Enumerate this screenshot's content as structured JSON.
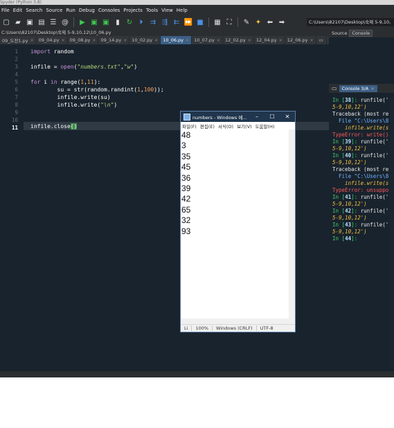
{
  "title_strip": "Spyder (Python 3.8)",
  "menubar": [
    "File",
    "Edit",
    "Search",
    "Source",
    "Run",
    "Debug",
    "Consoles",
    "Projects",
    "Tools",
    "View",
    "Help"
  ],
  "toolbar": {
    "path": "C:\\Users\\82107\\Desktop\\숙제 5-9,10,"
  },
  "editor": {
    "filepath": "C:\\Users\\82107\\Desktop\\숙제 5-9,10,12\\10_06.py",
    "tabs": [
      "09_도전1.py",
      "09_04.py",
      "09_08.py",
      "09_14.py",
      "10_02.py",
      "10_06.py",
      "10_07.py",
      "12_02.py",
      "12_04.py",
      "12_06.py"
    ],
    "active_tab": "10_06.py",
    "line_numbers": [
      "1",
      "2",
      "3",
      "4",
      "5",
      "6",
      "7",
      "8",
      "9",
      "10",
      "11"
    ],
    "current_line": "11",
    "code": {
      "l1_kw": "import",
      "l1_rest": " random",
      "l3_a": "infile = ",
      "l3_fn": "open",
      "l3_b": "(",
      "l3_s1": "\"numbers.txt\"",
      "l3_c": ",",
      "l3_s2": "\"w\"",
      "l3_d": ")",
      "l5_kw1": "for",
      "l5_a": " i ",
      "l5_kw2": "in",
      "l5_b": " range(",
      "l5_n1": "1",
      "l5_c": ",",
      "l5_n2": "11",
      "l5_d": "):",
      "l6_a": "        su = str(random.randint(",
      "l6_n1": "1",
      "l6_b": ",",
      "l6_n2": "100",
      "l6_c": "));",
      "l7": "        infile.write(su)",
      "l8_a": "        infile.write(",
      "l8_s": "\"\\n\"",
      "l8_b": ")",
      "l11_a": "infile.close",
      "l11_b": "()"
    }
  },
  "right_pane": {
    "tabs": [
      "Source",
      "Console"
    ],
    "console_tab": "Console 3/A"
  },
  "console": {
    "lines": [
      {
        "t": "In [38]: runfile('",
        "k": "pr"
      },
      {
        "t": "5-9,10,12')",
        "k": "ita"
      },
      {
        "t": "Traceback (most re",
        "k": "plain"
      },
      {
        "t": "",
        "k": "plain"
      },
      {
        "t": "  File \"C:\\Users\\8",
        "k": "blue"
      },
      {
        "t": "    infile.write(s",
        "k": "ita"
      },
      {
        "t": "",
        "k": "plain"
      },
      {
        "t": "TypeError: write()",
        "k": "err"
      },
      {
        "t": "",
        "k": "plain"
      },
      {
        "t": "",
        "k": "plain"
      },
      {
        "t": "In [39]: runfile('",
        "k": "pr"
      },
      {
        "t": "5-9,10,12')",
        "k": "ita"
      },
      {
        "t": "",
        "k": "plain"
      },
      {
        "t": "In [40]: runfile('",
        "k": "pr"
      },
      {
        "t": "5-9,10,12')",
        "k": "ita"
      },
      {
        "t": "Traceback (most re",
        "k": "plain"
      },
      {
        "t": "",
        "k": "plain"
      },
      {
        "t": "  File \"C:\\Users\\8",
        "k": "blue"
      },
      {
        "t": "    infile.write(s",
        "k": "ita"
      },
      {
        "t": "",
        "k": "plain"
      },
      {
        "t": "TypeError: unsuppo",
        "k": "err"
      },
      {
        "t": "",
        "k": "plain"
      },
      {
        "t": "",
        "k": "plain"
      },
      {
        "t": "In [41]: runfile('",
        "k": "pr"
      },
      {
        "t": "5-9,10,12')",
        "k": "ita"
      },
      {
        "t": "",
        "k": "plain"
      },
      {
        "t": "In [42]: runfile('",
        "k": "pr"
      },
      {
        "t": "5-9,10,12')",
        "k": "ita"
      },
      {
        "t": "",
        "k": "plain"
      },
      {
        "t": "In [43]: runfile('",
        "k": "pr"
      },
      {
        "t": "5-9,10,12')",
        "k": "ita"
      },
      {
        "t": "",
        "k": "plain"
      },
      {
        "t": "In [44]:",
        "k": "pr"
      }
    ]
  },
  "notepad": {
    "title": "numbers - Windows 메...",
    "menu": [
      "파일(F)",
      "편집(E)",
      "서식(O)",
      "보기(V)",
      "도움말(H)"
    ],
    "lines": [
      "48",
      "3",
      "35",
      "45",
      "36",
      "39",
      "42",
      "65",
      "32",
      "93"
    ],
    "status": {
      "pos": "Li",
      "zoom": "100%",
      "eol": "Windows (CRLF)",
      "enc": "UTF-8"
    }
  }
}
